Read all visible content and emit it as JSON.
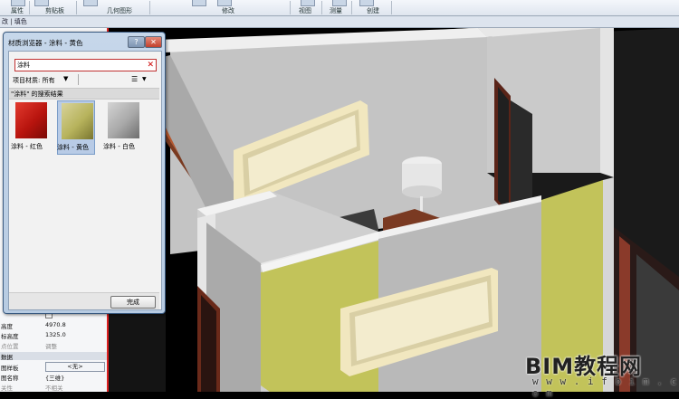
{
  "ribbon": {
    "groups": [
      "属性",
      "剪贴板",
      "几何图形",
      "修改",
      "视图",
      "测量",
      "创建"
    ]
  },
  "subbar": {
    "text": "改 | 填色"
  },
  "dialog": {
    "title": "材质浏览器 - 涂料 - 黄色",
    "help": "?",
    "close": "✕",
    "search_value": "涂料",
    "search_clear": "✕",
    "filter_label": "项目材质: 所有",
    "filter_arrow": "▼",
    "view_icon": "☰",
    "view_arrow": "▼",
    "results_header": "\"涂料\" 的搜索结果",
    "materials": [
      {
        "label": "涂料 - 红色",
        "color": "#c8201a",
        "selected": false
      },
      {
        "label": "涂料 - 黄色",
        "color": "#b7b35c",
        "selected": true
      },
      {
        "label": "涂料 - 白色",
        "color": "#a8a8a8",
        "selected": false
      }
    ],
    "done": "完成"
  },
  "properties": {
    "rows": [
      {
        "key": "",
        "value": "",
        "type": "checkbox"
      },
      {
        "key": "高度",
        "value": "4970.8"
      },
      {
        "key": "标高度",
        "value": "1325.0"
      },
      {
        "key": "点位置",
        "value": "调整",
        "gray": true
      }
    ],
    "section": "数据",
    "template_key": "图样板",
    "template_value": "<无>",
    "name_key": "图名称",
    "name_value": "{三维}",
    "dep_key": "关性",
    "dep_value": "不相关"
  },
  "watermark": {
    "main": "BIM教程网",
    "url": "w w w . i f b i m . c o m"
  },
  "colors": {
    "paint_yellow": "#c2c35a",
    "wall_gray": "#b9b9b9",
    "floor_white": "#e8e8e8",
    "wood": "#b5572e",
    "frame_cream": "#f1e7bf",
    "viewport_border": "#dd2222"
  }
}
